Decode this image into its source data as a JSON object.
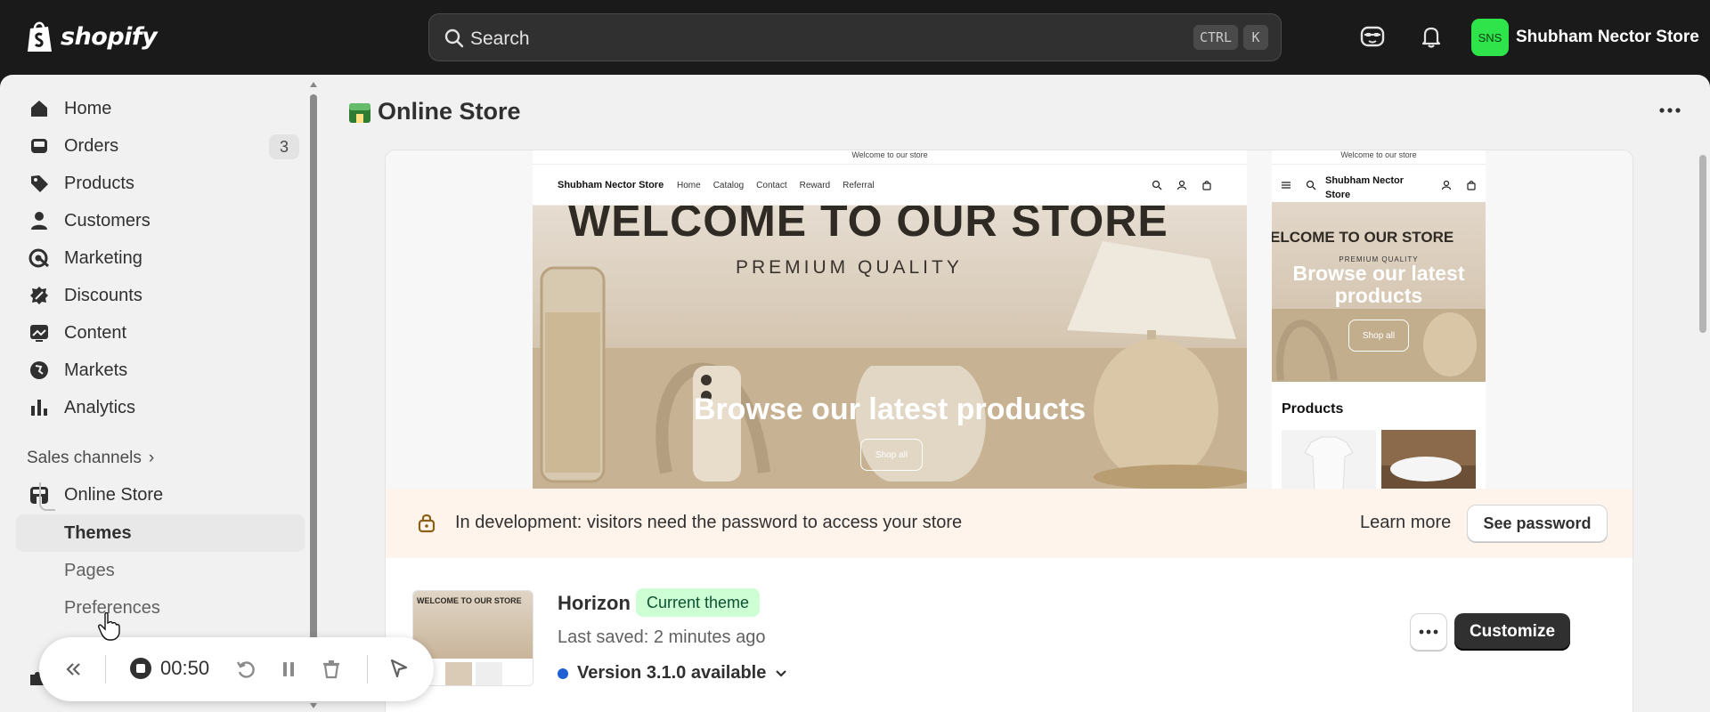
{
  "topbar": {
    "logo_text": "shopify",
    "search_placeholder": "Search",
    "shortcut_ctrl": "CTRL",
    "shortcut_k": "K",
    "store_initials": "SNS",
    "store_name": "Shubham Nector Store",
    "avatar_color": "#2fe34a"
  },
  "sidebar": {
    "items": [
      {
        "label": "Home",
        "icon": "home-icon"
      },
      {
        "label": "Orders",
        "icon": "inbox-icon",
        "badge": "3"
      },
      {
        "label": "Products",
        "icon": "tag-icon"
      },
      {
        "label": "Customers",
        "icon": "person-icon"
      },
      {
        "label": "Marketing",
        "icon": "target-icon"
      },
      {
        "label": "Discounts",
        "icon": "discount-icon"
      },
      {
        "label": "Content",
        "icon": "image-icon"
      },
      {
        "label": "Markets",
        "icon": "globe-icon"
      },
      {
        "label": "Analytics",
        "icon": "bar-chart-icon"
      }
    ],
    "sales_channels_label": "Sales channels",
    "online_store_label": "Online Store",
    "sub_items": [
      {
        "label": "Themes"
      },
      {
        "label": "Pages"
      },
      {
        "label": "Preferences"
      }
    ]
  },
  "recorder": {
    "time": "00:50"
  },
  "main": {
    "title": "Online Store",
    "preview": {
      "announcement": "Welcome to our store",
      "brand": "Shubham Nector Store",
      "nav_links": [
        "Home",
        "Catalog",
        "Contact",
        "Reward",
        "Referral"
      ],
      "hero_heading": "WELCOME TO OUR STORE",
      "hero_sub": "PREMIUM QUALITY",
      "hero_title": "Browse our latest products",
      "hero_button": "Shop all",
      "mobile_brand": "Shubham Nector Store",
      "mobile_heading": "ELCOME TO OUR STORE",
      "mobile_sub": "PREMIUM QUALITY",
      "mobile_title": "Browse our latest products",
      "mobile_button": "Shop all",
      "products_heading": "Products"
    },
    "banner": {
      "text": "In development: visitors need the password to access your store",
      "learn_more": "Learn more",
      "see_password": "See password"
    },
    "theme": {
      "thumb_text": "WELCOME TO OUR STORE",
      "name": "Horizon",
      "badge": "Current theme",
      "last_saved": "Last saved: 2 minutes ago",
      "version": "Version 3.1.0 available",
      "customize": "Customize"
    }
  },
  "colors": {
    "topbar_bg": "#1a1a1a",
    "banner_bg": "#fff4ec",
    "current_badge_bg": "#cdfed4",
    "version_dot": "#1f5fd6",
    "customize_bg": "#303030"
  }
}
